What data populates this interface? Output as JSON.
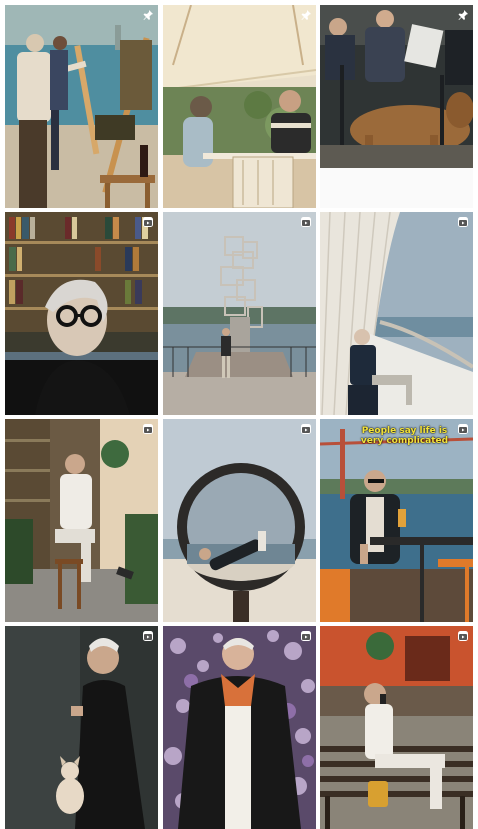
{
  "posts": [
    {
      "icon": "pin-icon"
    },
    {
      "icon": "pin-icon"
    },
    {
      "icon": "pin-icon"
    },
    {
      "icon": "reel-icon"
    },
    {
      "icon": "reel-icon"
    },
    {
      "icon": "reel-icon"
    },
    {
      "icon": "reel-icon"
    },
    {
      "icon": "reel-icon"
    },
    {
      "icon": "reel-icon",
      "caption_line1": "People say life is",
      "caption_line2": "very complicated"
    },
    {
      "icon": "reel-icon"
    },
    {
      "icon": "reel-icon"
    },
    {
      "icon": "reel-icon"
    }
  ],
  "colors": {
    "caption": "#f2e23a",
    "badge": "#ffffff"
  }
}
